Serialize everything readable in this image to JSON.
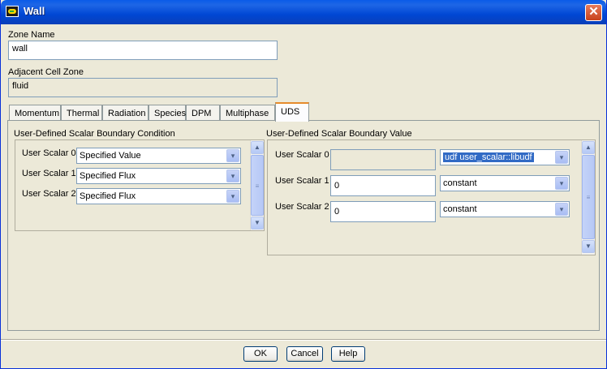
{
  "window": {
    "title": "Wall",
    "close_icon": "close-icon"
  },
  "zone_name": {
    "label": "Zone Name",
    "value": "wall"
  },
  "adjacent_cell_zone": {
    "label": "Adjacent Cell Zone",
    "value": "fluid"
  },
  "tabs": [
    {
      "label": "Momentum",
      "active": false
    },
    {
      "label": "Thermal",
      "active": false
    },
    {
      "label": "Radiation",
      "active": false
    },
    {
      "label": "Species",
      "active": false
    },
    {
      "label": "DPM",
      "active": false
    },
    {
      "label": "Multiphase",
      "active": false
    },
    {
      "label": "UDS",
      "active": true
    }
  ],
  "bc_group": {
    "title": "User-Defined Scalar Boundary Condition",
    "rows": [
      {
        "label": "User Scalar 0",
        "value": "Specified Value"
      },
      {
        "label": "User Scalar 1",
        "value": "Specified Flux"
      },
      {
        "label": "User Scalar 2",
        "value": "Specified Flux"
      }
    ]
  },
  "bv_group": {
    "title": "User-Defined Scalar Boundary Value",
    "rows": [
      {
        "label": "User Scalar 0",
        "value": "",
        "method": "udf user_scalar::libudf"
      },
      {
        "label": "User Scalar 1",
        "value": "0",
        "method": "constant"
      },
      {
        "label": "User Scalar 2",
        "value": "0",
        "method": "constant"
      }
    ]
  },
  "buttons": {
    "ok": "OK",
    "cancel": "Cancel",
    "help": "Help"
  },
  "icons": {
    "dropdown": "▾",
    "scroll_up": "▲",
    "scroll_down": "▼",
    "thumb_grip": "≡",
    "close": "✕"
  }
}
